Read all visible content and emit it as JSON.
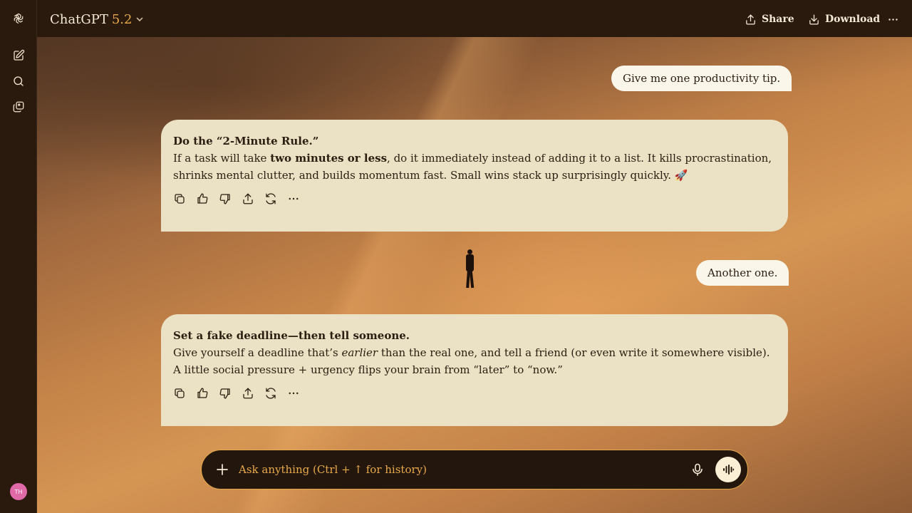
{
  "header": {
    "model_name": "ChatGPT",
    "model_version": "5.2",
    "share_label": "Share",
    "download_label": "Download"
  },
  "sidebar": {
    "avatar_initials": "TH"
  },
  "conversation": [
    {
      "role": "user",
      "text": "Give me one productivity tip."
    },
    {
      "role": "assistant",
      "title": "Do the “2-Minute Rule.”",
      "body_pre": "If a task will take ",
      "body_bold": "two minutes or less",
      "body_post": ", do it immediately instead of adding it to a list. It kills procrastination, shrinks mental clutter, and builds momentum fast. Small wins stack up surprisingly quickly. 🚀"
    },
    {
      "role": "user",
      "text": "Another one."
    },
    {
      "role": "assistant",
      "title": "Set a fake deadline—then tell someone.",
      "body_pre": "Give yourself a deadline that’s ",
      "body_italic": "earlier",
      "body_post": " than the real one, and tell a friend (or even write it somewhere visible). A little social pressure + urgency flips your brain from “later” to “now.”"
    }
  ],
  "composer": {
    "placeholder": "Ask anything (Ctrl + ↑ for history)"
  },
  "icons": {
    "logo": "openai-logo-icon",
    "new_chat": "edit-icon",
    "search": "search-icon",
    "library": "images-icon",
    "copy": "copy-icon",
    "thumbs_up": "thumbs-up-icon",
    "thumbs_down": "thumbs-down-icon",
    "share": "share-icon",
    "regenerate": "regenerate-icon",
    "more": "more-icon",
    "plus": "plus-icon",
    "mic": "mic-icon",
    "voice": "voice-mode-icon"
  },
  "colors": {
    "accent": "#e7a94a",
    "bubble": "#ebe1c4",
    "user_bubble": "#fbf6ea",
    "chrome": "#2a1a0e"
  }
}
